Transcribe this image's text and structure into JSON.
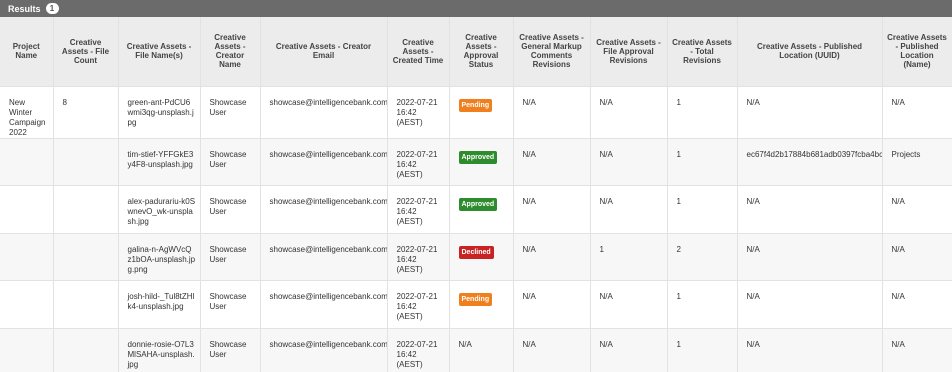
{
  "results": {
    "label": "Results",
    "count": "1"
  },
  "columns": [
    "Project Name",
    "Creative Assets - File Count",
    "Creative Assets - File Name(s)",
    "Creative Assets - Creator Name",
    "Creative Assets - Creator Email",
    "Creative Assets - Created Time",
    "Creative Assets - Approval Status",
    "Creative Assets - General Markup Comments Revisions",
    "Creative Assets - File Approval Revisions",
    "Creative Assets - Total Revisions",
    "Creative Assets - Published Location (UUID)",
    "Creative Assets - Published Location (Name)"
  ],
  "status_colors": {
    "Pending": "#f07f1e",
    "Approved": "#2e8b2e",
    "Declined": "#c82222"
  },
  "rows": [
    {
      "project": "New Winter Campaign 2022",
      "file_count": "8",
      "file_name": "green-ant-PdCU6wmi3qg-unsplash.jpg",
      "creator": "Showcase User",
      "email": "showcase@intelligencebank.com",
      "created": "2022-07-21 16:42 (AEST)",
      "status": "Pending",
      "markup": "N/A",
      "file_approval": "N/A",
      "total": "1",
      "uuid": "N/A",
      "location": "N/A"
    },
    {
      "project": "",
      "file_count": "",
      "file_name": "tim-stief-YFFGkE3y4F8-unsplash.jpg",
      "creator": "Showcase User",
      "email": "showcase@intelligencebank.com",
      "created": "2022-07-21 16:42 (AEST)",
      "status": "Approved",
      "markup": "N/A",
      "file_approval": "N/A",
      "total": "1",
      "uuid": "ec67f4d2b17884b681adb0397fcba4bc",
      "location": "Projects"
    },
    {
      "project": "",
      "file_count": "",
      "file_name": "alex-padurariu-k0SwnevO_wk-unsplash.jpg",
      "creator": "Showcase User",
      "email": "showcase@intelligencebank.com",
      "created": "2022-07-21 16:42 (AEST)",
      "status": "Approved",
      "markup": "N/A",
      "file_approval": "N/A",
      "total": "1",
      "uuid": "N/A",
      "location": "N/A"
    },
    {
      "project": "",
      "file_count": "",
      "file_name": "galina-n-AgWVcQz1bOA-unsplash.jpg.png",
      "creator": "Showcase User",
      "email": "showcase@intelligencebank.com",
      "created": "2022-07-21 16:42 (AEST)",
      "status": "Declined",
      "markup": "N/A",
      "file_approval": "1",
      "total": "2",
      "uuid": "N/A",
      "location": "N/A"
    },
    {
      "project": "",
      "file_count": "",
      "file_name": "josh-hild-_Tul8tZHlk4-unsplash.jpg",
      "creator": "Showcase User",
      "email": "showcase@intelligencebank.com",
      "created": "2022-07-21 16:42 (AEST)",
      "status": "Pending",
      "markup": "N/A",
      "file_approval": "N/A",
      "total": "1",
      "uuid": "N/A",
      "location": "N/A"
    },
    {
      "project": "",
      "file_count": "",
      "file_name": "donnie-rosie-O7L3MlSAHA-unsplash.jpg",
      "creator": "Showcase User",
      "email": "showcase@intelligencebank.com",
      "created": "2022-07-21 16:42 (AEST)",
      "status": "N/A",
      "markup": "N/A",
      "file_approval": "N/A",
      "total": "1",
      "uuid": "N/A",
      "location": "N/A"
    }
  ]
}
